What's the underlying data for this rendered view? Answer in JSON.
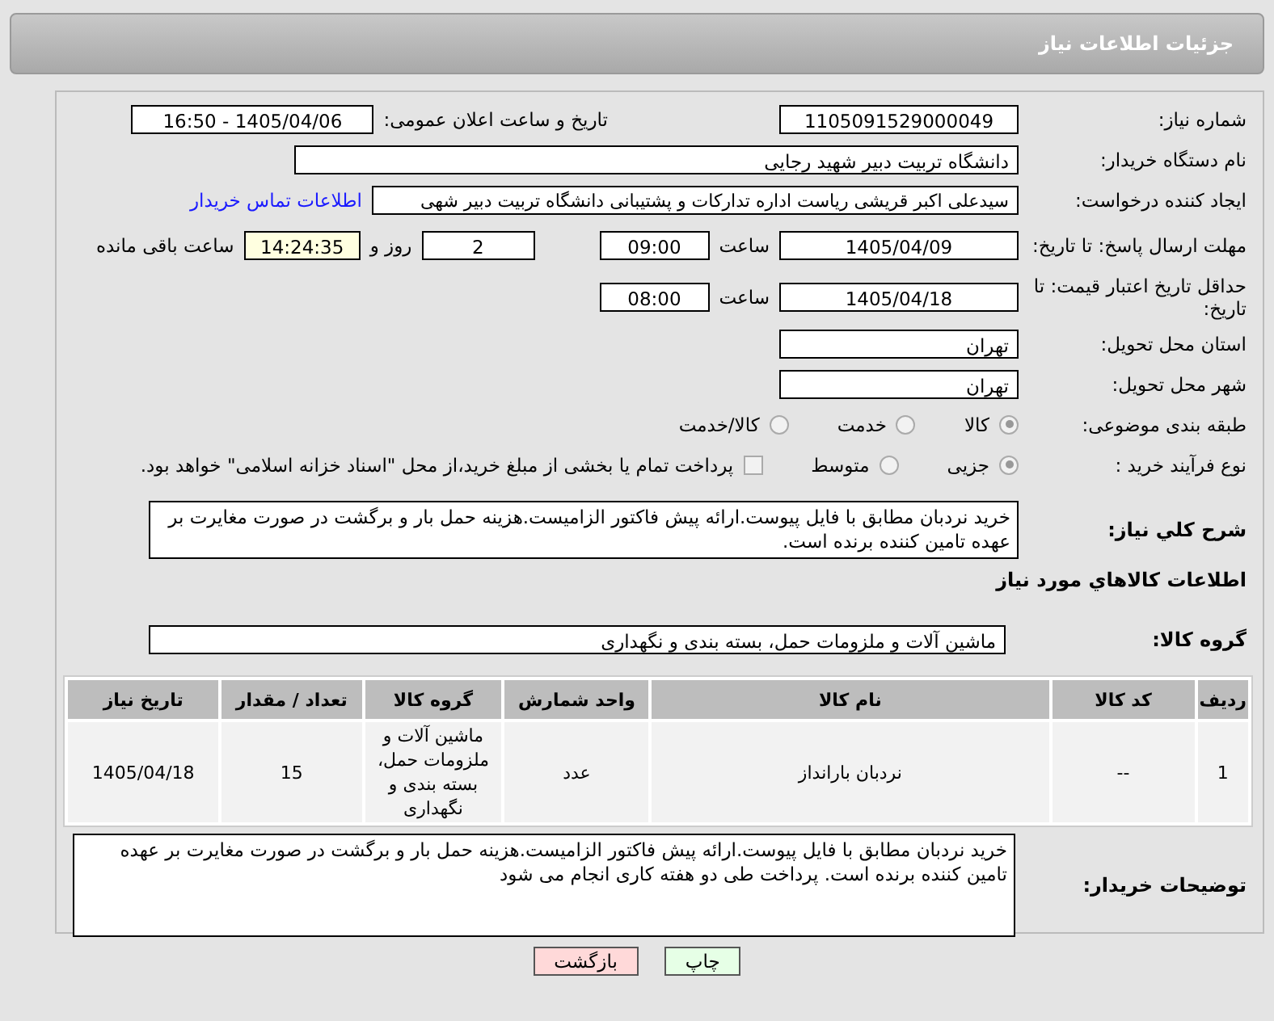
{
  "page_title": "جزئیات اطلاعات نیاز",
  "need_number": {
    "label": "شماره نیاز:",
    "value": "1105091529000049"
  },
  "announce": {
    "label": "تاریخ و ساعت اعلان عمومی:",
    "value": "1405/04/06 - 16:50"
  },
  "buyer": {
    "label": "نام دستگاه خریدار:",
    "value": "دانشگاه تربیت دبیر شهید رجایی"
  },
  "requester": {
    "label": "ایجاد کننده درخواست:",
    "value": "سیدعلی اکبر قریشی ریاست اداره تدارکات و پشتیبانی دانشگاه تربیت دبیر شهی",
    "link": "اطلاعات تماس خریدار"
  },
  "deadline": {
    "label": "مهلت ارسال پاسخ: تا تاریخ:",
    "date": "1405/04/09",
    "time_label": "ساعت",
    "time": "09:00",
    "days": "2",
    "days_label": "روز و",
    "remaining": "14:24:35",
    "remaining_label": "ساعت باقی مانده"
  },
  "validity": {
    "label": "حداقل تاریخ اعتبار قیمت: تا تاریخ:",
    "date": "1405/04/18",
    "time_label": "ساعت",
    "time": "08:00"
  },
  "province": {
    "label": "استان محل تحویل:",
    "value": "تهران"
  },
  "city": {
    "label": "شهر محل تحویل:",
    "value": "تهران"
  },
  "category": {
    "label": "طبقه بندی موضوعی:",
    "options": [
      {
        "label": "کالا",
        "selected": true
      },
      {
        "label": "خدمت",
        "selected": false
      },
      {
        "label": "کالا/خدمت",
        "selected": false
      }
    ]
  },
  "process": {
    "label": "نوع فرآیند خرید :",
    "options": [
      {
        "label": "جزیی",
        "selected": true
      },
      {
        "label": "متوسط",
        "selected": false
      }
    ],
    "payment": {
      "label": "پرداخت تمام یا بخشی از مبلغ خرید،از محل \"اسناد خزانه اسلامی\" خواهد بود.",
      "checked": false
    }
  },
  "description": {
    "label": "شرح کلي نياز:",
    "value": "خرید نردبان مطابق با فایل پیوست.ارائه پیش فاکتور الزامیست.هزینه حمل بار و برگشت در صورت مغایرت بر عهده تامین کننده برنده است."
  },
  "goods_title": "اطلاعات کالاهاي مورد نياز",
  "goods_group": {
    "label": "گروه کالا:",
    "value": "ماشین آلات و ملزومات حمل، بسته بندی و نگهداری"
  },
  "table": {
    "columns": [
      "ردیف",
      "کد کالا",
      "نام کالا",
      "واحد شمارش",
      "گروه کالا",
      "تعداد / مقدار",
      "تاریخ نیاز"
    ],
    "rows": [
      [
        "1",
        "--",
        "نردبان بارانداز",
        "عدد",
        "ماشین آلات و ملزومات حمل، بسته بندی و نگهداری",
        "15",
        "1405/04/18"
      ]
    ]
  },
  "buyer_notes": {
    "label": "توضیحات خریدار:",
    "value": "خرید نردبان مطابق با فایل پیوست.ارائه پیش فاکتور الزامیست.هزینه حمل بار و برگشت در صورت مغایرت بر عهده تامین کننده برنده است. پرداخت طی دو هفته کاری انجام می شود"
  },
  "buttons": [
    {
      "label": "چاپ",
      "kind": "print"
    },
    {
      "label": "بازگشت",
      "kind": "back"
    }
  ]
}
